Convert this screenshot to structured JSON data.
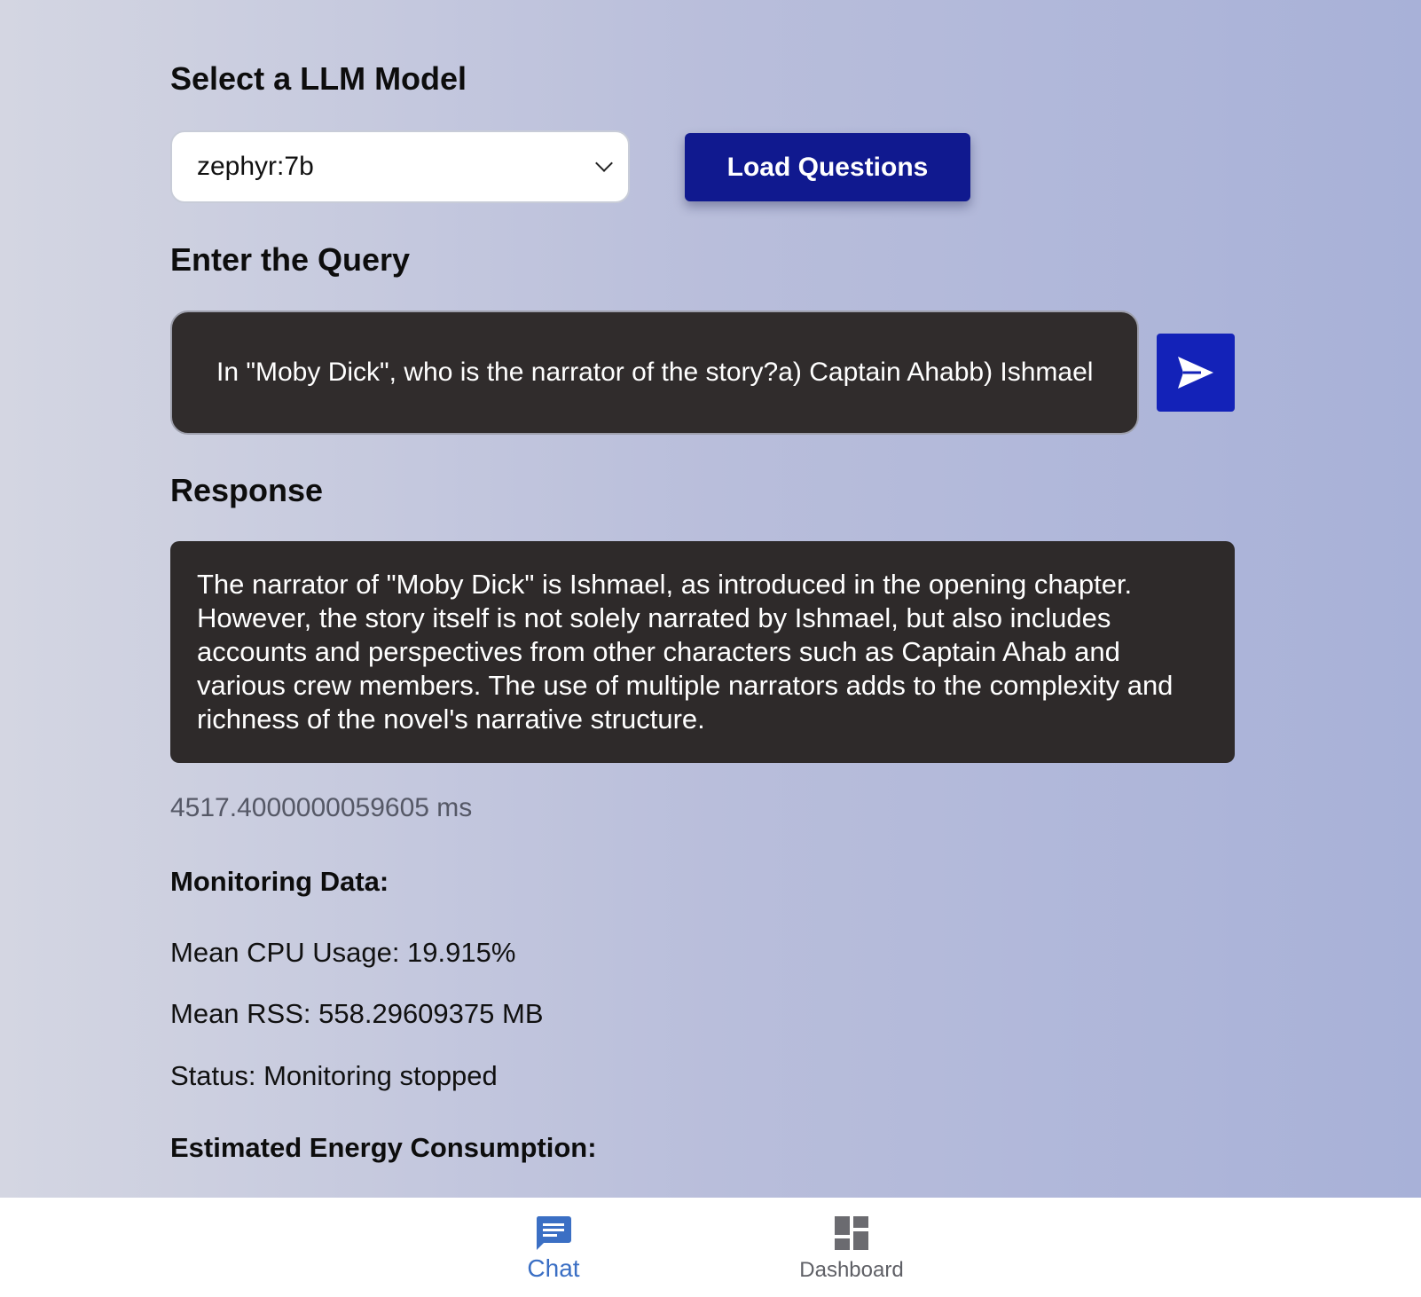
{
  "model_section": {
    "heading": "Select a LLM Model",
    "selected_model": "zephyr:7b",
    "load_button_label": "Load Questions"
  },
  "query_section": {
    "heading": "Enter the Query",
    "query_value": "In \"Moby Dick\", who is the narrator of the story?a) Captain Ahabb) Ishmael"
  },
  "response_section": {
    "heading": "Response",
    "text": "The narrator of \"Moby Dick\" is Ishmael, as introduced in the opening chapter. However, the story itself is not solely narrated by Ishmael, but also includes accounts and perspectives from other characters such as Captain Ahab and various crew members. The use of multiple narrators adds to the complexity and richness of the novel's narrative structure.",
    "elapsed": "4517.4000000059605 ms"
  },
  "monitoring": {
    "heading": "Monitoring Data:",
    "cpu": "Mean CPU Usage: 19.915%",
    "rss": "Mean RSS: 558.29609375 MB",
    "status": "Status: Monitoring stopped"
  },
  "energy": {
    "heading": "Estimated Energy Consumption:"
  },
  "bottom_nav": {
    "items": [
      {
        "label": "Chat",
        "icon": "chat-icon",
        "active": true
      },
      {
        "label": "Dashboard",
        "icon": "dashboard-icon",
        "active": false
      }
    ]
  },
  "colors": {
    "primary_button": "#10198f",
    "send_button": "#1322b8",
    "dark_panel": "#2e2a2a",
    "active_nav": "#3b6fc4",
    "inactive_nav": "#5f6066"
  }
}
